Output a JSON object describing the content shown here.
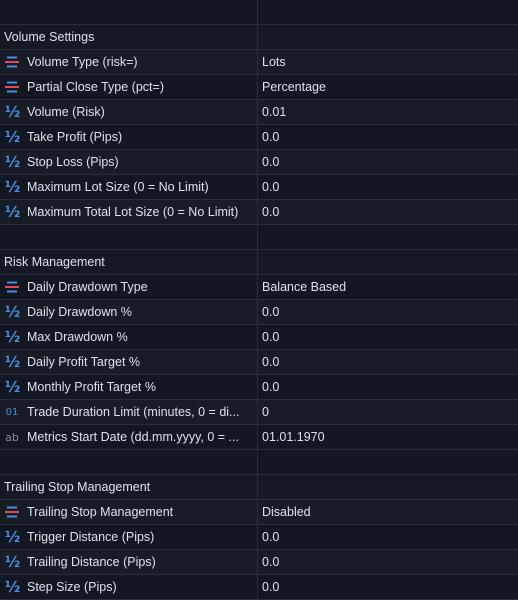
{
  "colors": {
    "background": "#131722",
    "row_alt": "#171c26",
    "grid_line": "#2a2e3a",
    "text": "#dfe2e8",
    "icon_blue": "#4a8fe0",
    "enum_red": "#e04a5a"
  },
  "rows": [
    {
      "type": "blank"
    },
    {
      "type": "section",
      "label": "Volume Settings"
    },
    {
      "type": "param",
      "icon": "enum-icon",
      "label": "Volume Type (risk=)",
      "value": "Lots"
    },
    {
      "type": "param",
      "icon": "enum-icon",
      "label": "Partial Close Type (pct=)",
      "value": "Percentage"
    },
    {
      "type": "param",
      "icon": "double-icon",
      "label": "Volume (Risk)",
      "value": "0.01"
    },
    {
      "type": "param",
      "icon": "double-icon",
      "label": "Take Profit (Pips)",
      "value": "0.0"
    },
    {
      "type": "param",
      "icon": "double-icon",
      "label": "Stop Loss (Pips)",
      "value": "0.0"
    },
    {
      "type": "param",
      "icon": "double-icon",
      "label": "Maximum Lot Size (0 = No Limit)",
      "value": "0.0"
    },
    {
      "type": "param",
      "icon": "double-icon",
      "label": "Maximum Total Lot Size (0 = No Limit)",
      "value": "0.0"
    },
    {
      "type": "blank"
    },
    {
      "type": "section",
      "label": "Risk Management"
    },
    {
      "type": "param",
      "icon": "enum-icon",
      "label": "Daily Drawdown Type",
      "value": "Balance Based"
    },
    {
      "type": "param",
      "icon": "double-icon",
      "label": "Daily Drawdown %",
      "value": "0.0"
    },
    {
      "type": "param",
      "icon": "double-icon",
      "label": "Max Drawdown %",
      "value": "0.0"
    },
    {
      "type": "param",
      "icon": "double-icon",
      "label": "Daily Profit Target %",
      "value": "0.0"
    },
    {
      "type": "param",
      "icon": "double-icon",
      "label": "Monthly Profit Target %",
      "value": "0.0"
    },
    {
      "type": "param",
      "icon": "integer-icon",
      "label": "Trade Duration Limit (minutes, 0 = di...",
      "value": "0"
    },
    {
      "type": "param",
      "icon": "string-icon",
      "label": "Metrics Start Date (dd.mm.yyyy, 0 = ...",
      "value": "01.01.1970"
    },
    {
      "type": "blank"
    },
    {
      "type": "section",
      "label": "Trailing Stop Management"
    },
    {
      "type": "param",
      "icon": "enum-icon",
      "label": "Trailing Stop Management",
      "value": "Disabled"
    },
    {
      "type": "param",
      "icon": "double-icon",
      "label": "Trigger Distance (Pips)",
      "value": "0.0"
    },
    {
      "type": "param",
      "icon": "double-icon",
      "label": "Trailing Distance (Pips)",
      "value": "0.0"
    },
    {
      "type": "param",
      "icon": "double-icon",
      "label": "Step Size (Pips)",
      "value": "0.0"
    }
  ]
}
